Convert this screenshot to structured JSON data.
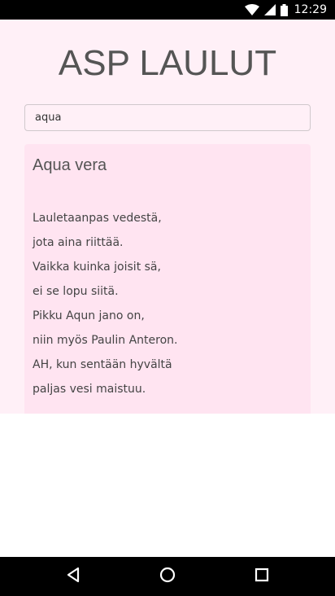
{
  "status_bar": {
    "time": "12:29",
    "icons": [
      "wifi-icon",
      "signal-icon",
      "battery-icon"
    ]
  },
  "app": {
    "title": "ASP LAULUT",
    "search": {
      "value": "aqua",
      "placeholder": ""
    },
    "song": {
      "title": "Aqua vera",
      "lyrics": [
        "Lauletaanpas vedestä,",
        "jota aina riittää.",
        "Vaikka kuinka joisit sä,",
        "ei se lopu siitä.",
        "Pikku Aqun jano on,",
        "niin myös Paulin Anteron.",
        "AH, kun sentään hyvältä",
        "paljas vesi maistuu."
      ]
    }
  },
  "nav_bar": {
    "icons": [
      "back-icon",
      "home-icon",
      "recents-icon"
    ]
  },
  "colors": {
    "app_background": "#fff0f7",
    "card_background": "#ffe4f1",
    "title_text": "#555555",
    "lyrics_text": "#444444"
  }
}
